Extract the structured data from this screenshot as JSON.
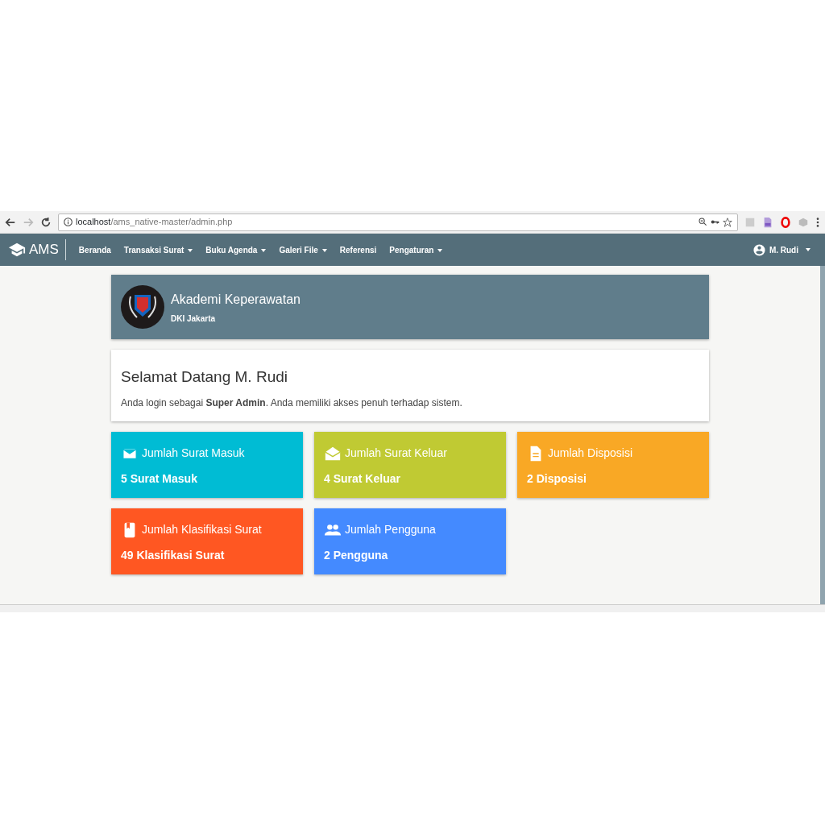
{
  "browser": {
    "url_host": "localhost",
    "url_path": "/ams_native-master/admin.php"
  },
  "navbar": {
    "brand": "AMS",
    "items": [
      {
        "label": "Beranda",
        "dropdown": false
      },
      {
        "label": "Transaksi Surat",
        "dropdown": true
      },
      {
        "label": "Buku Agenda",
        "dropdown": true
      },
      {
        "label": "Galeri File",
        "dropdown": true
      },
      {
        "label": "Referensi",
        "dropdown": false
      },
      {
        "label": "Pengaturan",
        "dropdown": true
      }
    ],
    "user": "M. Rudi"
  },
  "header": {
    "title": "Akademi Keperawatan",
    "subtitle": "DKI Jakarta"
  },
  "welcome": {
    "title": "Selamat Datang M. Rudi",
    "text": "Anda login sebagai **Super Admin**. Anda memiliki akses penuh terhadap sistem."
  },
  "stats": [
    {
      "kind": "mail",
      "title": "Jumlah Surat Masuk",
      "value": "5 Surat Masuk",
      "color": "#00bcd4"
    },
    {
      "kind": "drafts",
      "title": "Jumlah Surat Keluar",
      "value": "4 Surat Keluar",
      "color": "#c0ca33"
    },
    {
      "kind": "file",
      "title": "Jumlah Disposisi",
      "value": "2 Disposisi",
      "color": "#f9a825"
    },
    {
      "kind": "book",
      "title": "Jumlah Klasifikasi Surat",
      "value": "49 Klasifikasi Surat",
      "color": "#ff5722"
    },
    {
      "kind": "people",
      "title": "Jumlah Pengguna",
      "value": "2 Pengguna",
      "color": "#448aff"
    }
  ]
}
